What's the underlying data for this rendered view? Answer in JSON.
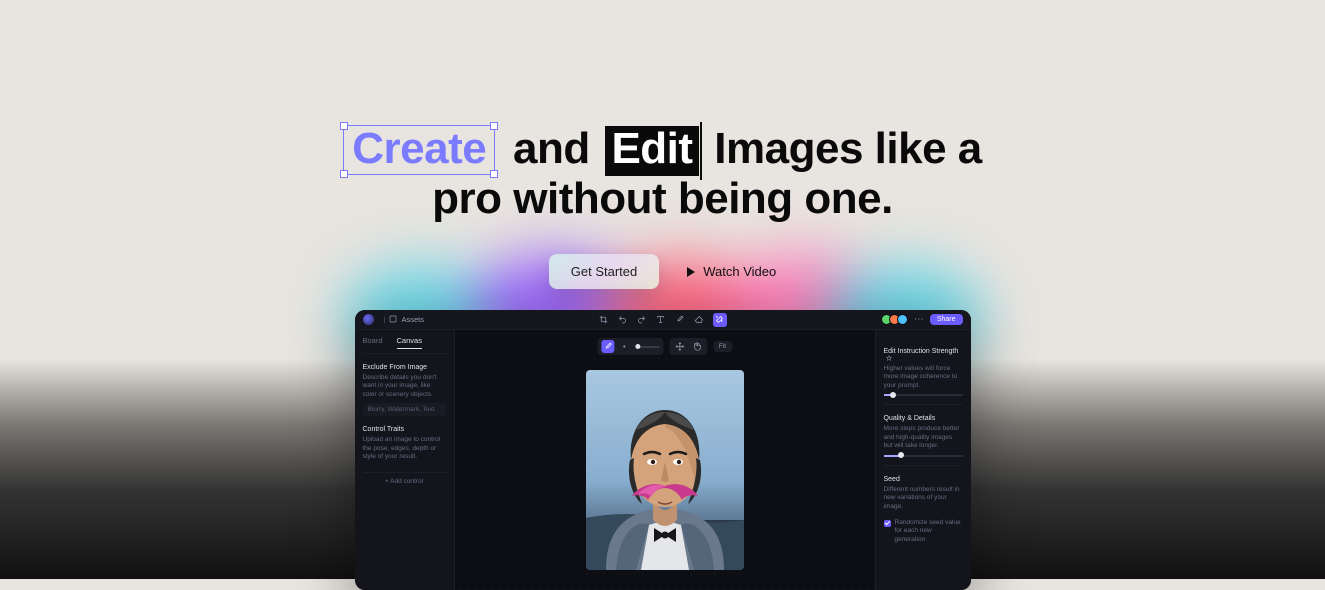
{
  "hero": {
    "word_create": "Create",
    "word_and": "and",
    "word_edit": "Edit",
    "rest_line1": "Images like a",
    "line2": "pro without being one.",
    "cta_primary": "Get Started",
    "cta_secondary": "Watch Video"
  },
  "app": {
    "breadcrumb": {
      "a": "",
      "b": "Assets"
    },
    "share_label": "Share",
    "canvas_toolbar": {
      "fit_label": "Fit"
    },
    "left": {
      "tabs": [
        "Board",
        "Canvas"
      ],
      "exclude": {
        "title": "Exclude From Image",
        "desc": "Describe details you don't want in your image, like color or scenery objects.",
        "placeholder": "Blurry, Watermark, Text"
      },
      "control": {
        "title": "Control Traits",
        "desc": "Upload an image to control the pose, edges, depth or style of your result.",
        "add": "+ Add control"
      }
    },
    "right": {
      "strength": {
        "title": "Edit Instruction Strength",
        "desc": "Higher values will force more image coherence to your prompt."
      },
      "quality": {
        "title": "Quality & Details",
        "desc": "More steps produce better and high-quality images but will take longer."
      },
      "seed": {
        "title": "Seed",
        "desc": "Different numbers result in new variations of your image."
      },
      "checkbox_label": "Randomize seed value for each new generation"
    }
  }
}
